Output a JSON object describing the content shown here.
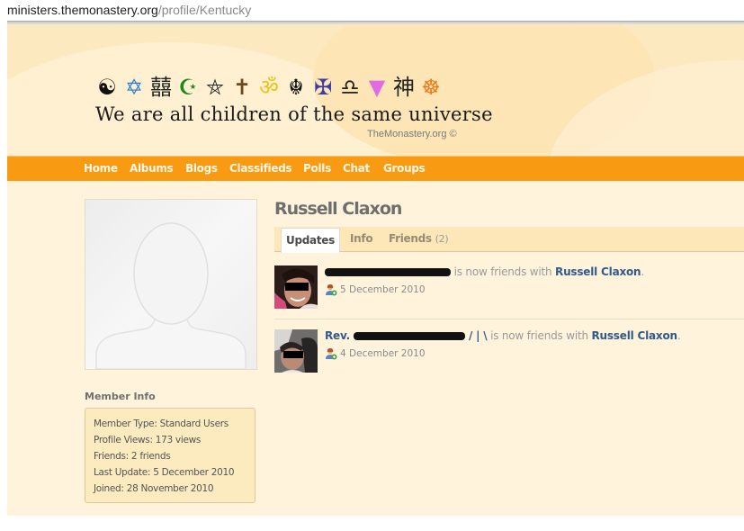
{
  "browser": {
    "url_host": "ministers.themonastery.org",
    "url_path": "/profile/Kentucky"
  },
  "header": {
    "symbol_icons": [
      "yin-yang",
      "star-of-david",
      "double-happiness",
      "islam-crescent",
      "pentacle",
      "latin-cross",
      "om",
      "khanda",
      "celtic-cross",
      "libra",
      "pink-triangle",
      "shinto-kanji",
      "dharma-wheel"
    ],
    "symbol_glyphs": [
      "☯",
      "✡",
      "囍",
      "☪",
      "⛤",
      "✝",
      "ॐ",
      "☬",
      "✠",
      "♎",
      "▼",
      "神",
      "☸"
    ],
    "symbol_colors": [
      "#111111",
      "#2b7bd6",
      "#222222",
      "#1e8a1e",
      "#222222",
      "#6b4a1f",
      "#e8c41a",
      "#111111",
      "#3c3ca8",
      "#222222",
      "#e06ce0",
      "#222222",
      "#f07a1a"
    ],
    "tagline": "We are all children of the same universe",
    "copyright": "TheMonastery.org ©"
  },
  "nav": {
    "items": [
      {
        "label": "Home"
      },
      {
        "label": "Albums"
      },
      {
        "label": "Blogs"
      },
      {
        "label": "Classifieds"
      },
      {
        "label": "Polls"
      },
      {
        "label": "Chat"
      },
      {
        "label": "Groups"
      }
    ]
  },
  "profile": {
    "name": "Russell Claxon",
    "tabs": [
      {
        "label": "Updates",
        "active": true
      },
      {
        "label": "Info"
      },
      {
        "label": "Friends",
        "count": "(2)"
      }
    ]
  },
  "feed": [
    {
      "actor_prefix": "",
      "actor_suffix": "",
      "action": " is now friends with ",
      "target": "Russell Claxon",
      "end": ".",
      "date": "5 December 2010",
      "icon": "add-friend-icon"
    },
    {
      "actor_prefix": "Rev. ",
      "actor_suffix": " / | \\",
      "action": " is now friends with ",
      "target": "Russell Claxon",
      "end": ".",
      "date": "4 December 2010",
      "icon": "add-friend-icon"
    }
  ],
  "member_info": {
    "title": "Member Info",
    "rows": [
      "Member Type: Standard Users",
      "Profile Views: 173 views",
      "Friends: 2 friends",
      "Last Update: 5 December 2010",
      "Joined: 28 November 2010"
    ]
  },
  "colors": {
    "nav_bg": "#f89a12",
    "link": "#2f5a8c",
    "page_bg": "#fff3dc"
  }
}
